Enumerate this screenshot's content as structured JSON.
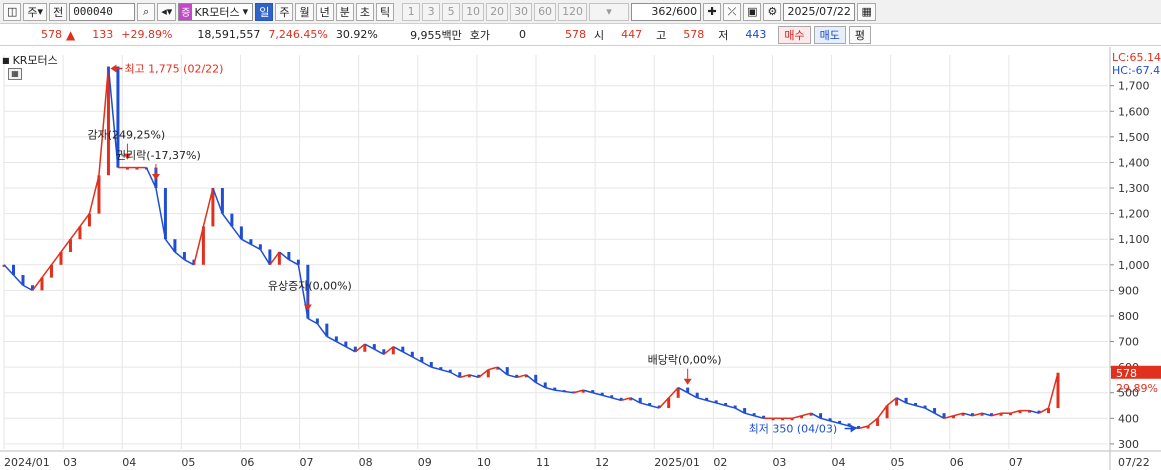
{
  "toolbar": {
    "period_select": "주",
    "prev_label": "전",
    "code": "000040",
    "stock_badge": "증",
    "stock_name": "KR모터스",
    "periods": [
      "일",
      "주",
      "월",
      "년",
      "분",
      "초",
      "틱"
    ],
    "active_period": "일",
    "intervals": [
      "1",
      "3",
      "5",
      "10",
      "20",
      "30",
      "60",
      "120"
    ],
    "count": "362",
    "count_total": "/600",
    "date": "2025/07/22"
  },
  "quote": {
    "price": "578",
    "change": "133",
    "change_pct": "+29.89%",
    "volume": "18,591,557",
    "volume_pct": "7,246.45%",
    "turnover": "30.92%",
    "amount": "9,955백만",
    "hoga_label": "호가",
    "hoga_value": "0",
    "hoga_price": "578",
    "open_label": "시",
    "open": "447",
    "high_label": "고",
    "high": "578",
    "low_label": "저",
    "low": "443",
    "buy_label": "매수",
    "sell_label": "매도",
    "avg_label": "평"
  },
  "chart": {
    "legend_name": "KR모터스",
    "lc_label": "LC:65.14",
    "hc_label": "HC:-67.4",
    "current_price": "578",
    "current_pct": "29.89%",
    "y_ticks": [
      "1,700",
      "1,600",
      "1,500",
      "1,400",
      "1,300",
      "1,200",
      "1,100",
      "1,000",
      "900",
      "800",
      "700",
      "600",
      "500",
      "400",
      "300"
    ],
    "x_ticks": [
      "2024/01",
      "03",
      "04",
      "05",
      "06",
      "07",
      "08",
      "09",
      "10",
      "11",
      "12",
      "2025/01",
      "02",
      "03",
      "04",
      "05",
      "06",
      "07",
      "07/22"
    ],
    "annotations": {
      "high": "최고 1,775 (02/22)",
      "low": "최저 350 (04/03)",
      "capital_reduction": "감자(249,25%)",
      "rights": "권리락(-17,37%)",
      "paid_in": "유상증자(0,00%)",
      "dividend": "배당락(0,00%)"
    },
    "colors": {
      "up": "#e0301e",
      "down": "#1f4fd0",
      "grid": "#e6e6e6"
    }
  },
  "chart_data": {
    "type": "candlestick",
    "title": "KR모터스",
    "ylim": [
      280,
      1820
    ],
    "x": [
      "2024/01",
      "03",
      "04",
      "05",
      "06",
      "07",
      "08",
      "09",
      "10",
      "11",
      "12",
      "2025/01",
      "02",
      "03",
      "04",
      "05",
      "06",
      "07",
      "07/22"
    ],
    "series": [
      {
        "values": [
          1000,
          960,
          920,
          900,
          950,
          1000,
          1050,
          1100,
          1150,
          1200,
          1350,
          1775,
          1380,
          1380,
          1380,
          1380,
          1300,
          1100,
          1050,
          1020,
          1000,
          1150,
          1300,
          1200,
          1150,
          1100,
          1080,
          1060,
          1000,
          1050,
          1020,
          1000,
          790,
          770,
          720,
          700,
          680,
          660,
          690,
          670,
          650,
          680,
          660,
          640,
          620,
          600,
          590,
          580,
          560,
          570,
          560,
          590,
          600,
          570,
          560,
          570,
          540,
          520,
          510,
          505,
          500,
          510,
          500,
          490,
          480,
          470,
          480,
          460,
          450,
          440,
          480,
          520,
          500,
          480,
          470,
          460,
          450,
          440,
          420,
          410,
          400,
          400,
          400,
          400,
          410,
          420,
          400,
          390,
          380,
          370,
          360,
          370,
          400,
          450,
          480,
          460,
          450,
          440,
          420,
          400,
          410,
          420,
          410,
          420,
          410,
          420,
          420,
          430,
          430,
          420,
          440,
          578
        ]
      }
    ]
  }
}
